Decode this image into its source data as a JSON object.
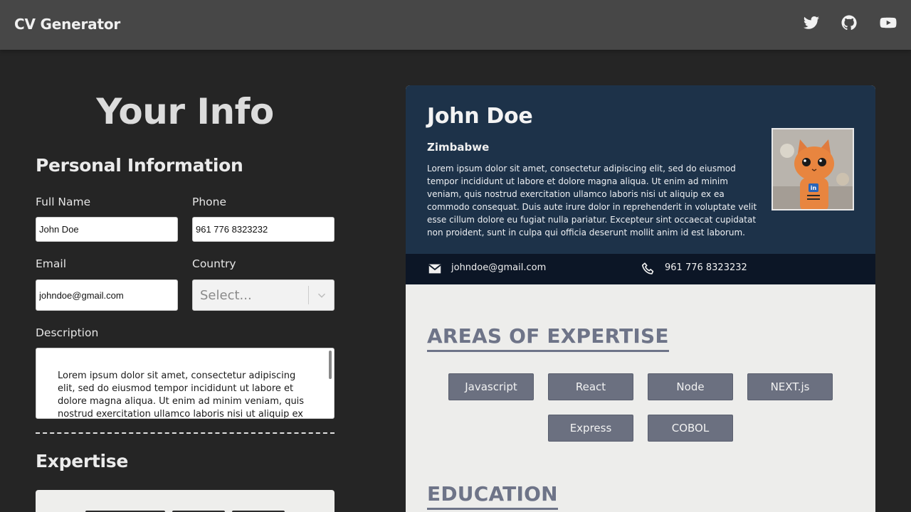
{
  "app": {
    "title": "CV Generator"
  },
  "social": [
    {
      "name": "twitter-icon"
    },
    {
      "name": "github-icon"
    },
    {
      "name": "youtube-icon"
    }
  ],
  "form": {
    "heading": "Your Info",
    "personal_title": "Personal Information",
    "full_name_label": "Full Name",
    "full_name_value": "John Doe",
    "phone_label": "Phone",
    "phone_value": "961 776 8323232",
    "email_label": "Email",
    "email_value": "johndoe@gmail.com",
    "country_label": "Country",
    "country_placeholder": "Select...",
    "description_label": "Description",
    "description_value": "Lorem ipsum dolor sit amet, consectetur adipiscing elit, sed do eiusmod tempor incididunt ut labore et dolore magna aliqua. Ut enim ad minim veniam, quis nostrud exercitation ullamco laboris nisi ut aliquip ex ea",
    "expertise_title": "Expertise"
  },
  "cv": {
    "name": "John Doe",
    "country": "Zimbabwe",
    "description": "Lorem ipsum dolor sit amet, consectetur adipiscing elit, sed do eiusmod tempor incididunt ut labore et dolore magna aliqua. Ut enim ad minim veniam, quis nostrud exercitation ullamco laboris nisi ut aliquip ex ea commodo consequat. Duis aute irure dolor in reprehenderit in voluptate velit esse cillum dolore eu fugiat nulla pariatur. Excepteur sint occaecat cupidatat non proident, sunt in culpa qui officia deserunt mollit anim id est laborum.",
    "email": "johndoe@gmail.com",
    "phone": "961 776 8323232",
    "expertise_title": "AREAS OF EXPERTISE",
    "skills": [
      "Javascript",
      "React",
      "Node",
      "NEXT.js",
      "Express",
      "COBOL"
    ],
    "education_title": "EDUCATION",
    "photo_badge": "in"
  },
  "colors": {
    "cv_header": "#1d3249",
    "cv_contact_bar": "#0c1626",
    "section_title": "#6e7488",
    "skill_chip": "#6b7080"
  }
}
